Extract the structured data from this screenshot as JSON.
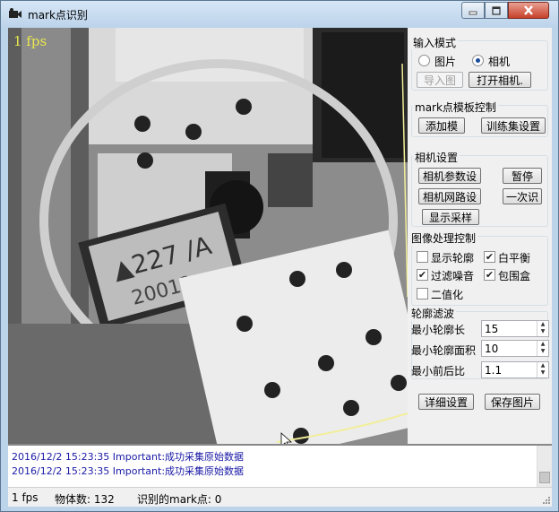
{
  "window": {
    "title": "mark点识别"
  },
  "camera": {
    "fps_overlay": "1 fps"
  },
  "input_mode": {
    "label": "输入模式",
    "options": [
      {
        "label": "图片",
        "selected": false
      },
      {
        "label": "相机",
        "selected": true
      }
    ],
    "import_button": "导入图",
    "open_camera_button": "打开相机."
  },
  "mark_template": {
    "label": "mark点模板控制",
    "add_button": "添加模",
    "train_button": "训练集设置"
  },
  "camera_settings": {
    "label": "相机设置",
    "params_button": "相机参数设",
    "pause_button": "暂停",
    "network_button": "相机网路设",
    "once_button": "一次识",
    "show_capture_button": "显示采样"
  },
  "image_processing": {
    "label": "图像处理控制",
    "checkboxes": [
      {
        "label": "显示轮廓",
        "checked": false
      },
      {
        "label": "白平衡",
        "checked": true
      },
      {
        "label": "过滤噪音",
        "checked": true
      },
      {
        "label": "包围盒",
        "checked": true
      },
      {
        "label": "二值化",
        "checked": false
      }
    ]
  },
  "contour_filter": {
    "label": "轮廓滤波",
    "fields": [
      {
        "label": "最小轮廓长",
        "value": "15"
      },
      {
        "label": "最小轮廓面积",
        "value": "10"
      },
      {
        "label": "最小前后比",
        "value": "1.1"
      }
    ]
  },
  "actions": {
    "details_button": "详细设置",
    "save_image_button": "保存图片"
  },
  "log": {
    "lines": [
      "2016/12/2 15:23:35 Important:成功采集原始数据",
      "2016/12/2 15:23:35 Important:成功采集原始数据"
    ]
  },
  "status": {
    "fps": "1 fps",
    "object_count": "物体数: 132",
    "mark_count": "识别的mark点: 0"
  }
}
